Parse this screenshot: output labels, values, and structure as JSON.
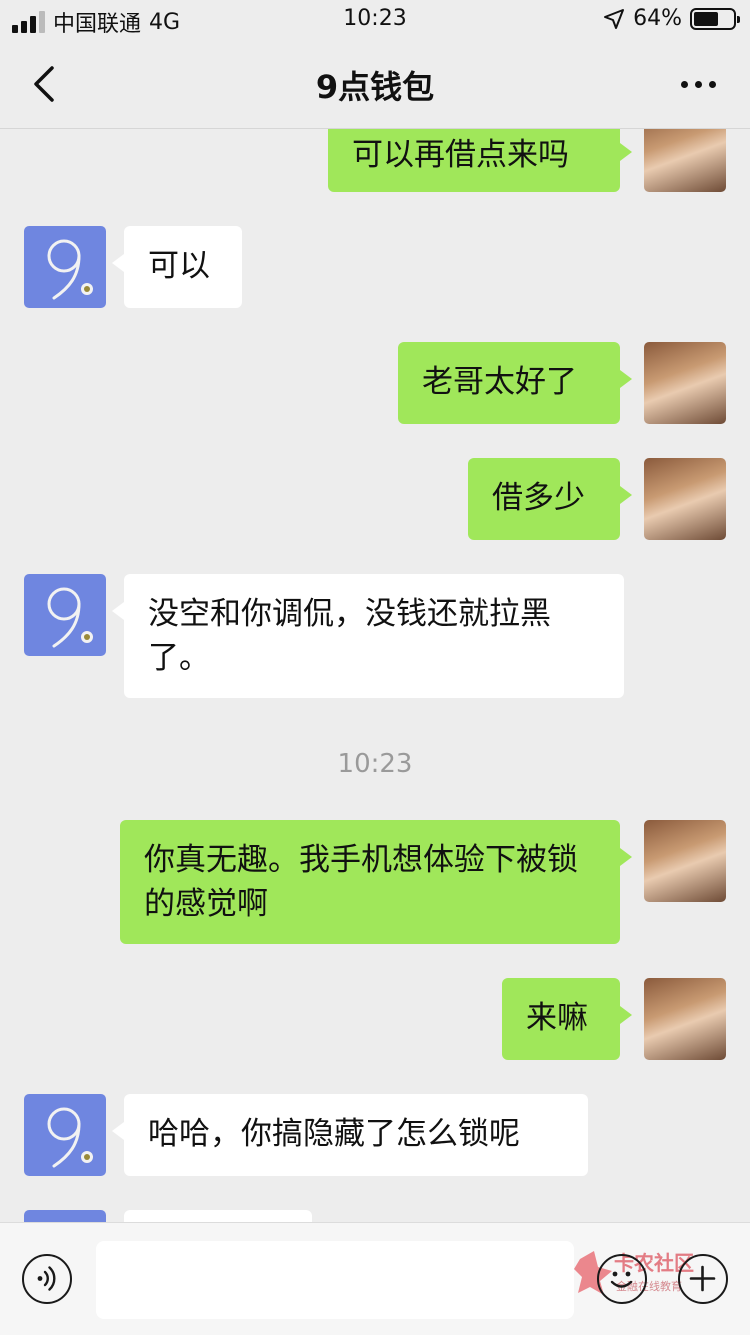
{
  "status_bar": {
    "carrier": "中国联通",
    "network": "4G",
    "time": "10:23",
    "battery": "64%",
    "battery_level": 0.64
  },
  "nav": {
    "title": "9点钱包"
  },
  "messages": [
    {
      "side": "me",
      "text": "可以再借点来吗"
    },
    {
      "side": "other",
      "text": "可以"
    },
    {
      "side": "me",
      "text": "老哥太好了"
    },
    {
      "side": "me",
      "text": "借多少"
    },
    {
      "side": "other",
      "text": "没空和你调侃，没钱还就拉黑了。"
    },
    {
      "side": "me",
      "text": "你真无趣。我手机想体验下被锁的感觉啊"
    },
    {
      "side": "me",
      "text": "来嘛"
    },
    {
      "side": "other",
      "text": "哈哈，你搞隐藏了怎么锁呢"
    }
  ],
  "timestamp": "10:23",
  "bot_avatar_glyph": "9",
  "input": {
    "value": ""
  },
  "watermark": {
    "name": "卡农社区",
    "tagline": "金融在线教育"
  },
  "colors": {
    "my_bubble": "#a0e75a",
    "other_bubble": "#ffffff",
    "bot_avatar": "#6f86e0",
    "background": "#ededed"
  },
  "icons": [
    "signal-icon",
    "location-icon",
    "battery-icon",
    "back-icon",
    "more-icon",
    "voice-icon",
    "emoji-icon",
    "plus-icon"
  ]
}
